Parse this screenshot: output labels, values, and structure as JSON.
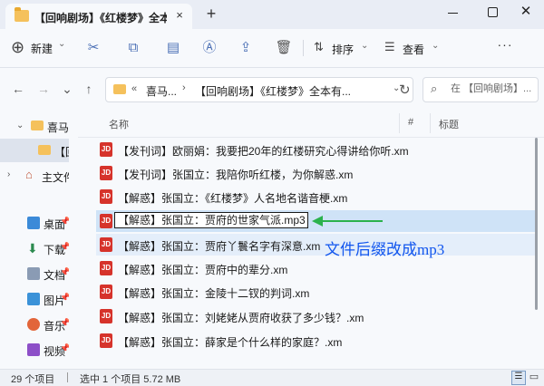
{
  "tab": {
    "title": "【回响剧场】《红楼梦》全本有",
    "close": "×",
    "new_tab": "+"
  },
  "window": {
    "close": "✕"
  },
  "toolbar": {
    "new_label": "新建",
    "sort_label": "排序",
    "view_label": "查看",
    "more_label": "···"
  },
  "address": {
    "prefix": "«",
    "segment1": "喜马...",
    "separator": "›",
    "segment2": "【回响剧场】《红楼梦》全本有...",
    "chevron": "⌄"
  },
  "search": {
    "placeholder": "在 【回响剧场】..."
  },
  "sidebar": {
    "items": [
      {
        "label": "喜马拉",
        "icon": "folder-icon",
        "expanded": true
      },
      {
        "label": "【回",
        "icon": "folder-icon",
        "selected": true
      },
      {
        "label": "主文件",
        "icon": "home-icon"
      },
      {
        "label": "桌面",
        "icon": "desktop-icon",
        "pinned": true
      },
      {
        "label": "下载",
        "icon": "download-icon",
        "pinned": true
      },
      {
        "label": "文档",
        "icon": "document-icon",
        "pinned": true
      },
      {
        "label": "图片",
        "icon": "picture-icon",
        "pinned": true
      },
      {
        "label": "音乐",
        "icon": "music-icon",
        "pinned": true
      },
      {
        "label": "视频",
        "icon": "video-icon",
        "pinned": true
      }
    ]
  },
  "list": {
    "columns": {
      "name": "名称",
      "number": "#",
      "title": "标题"
    },
    "file_icon_label": "JD",
    "files": [
      {
        "name": "【发刊词】欧丽娟：我要把20年的红楼研究心得讲给你听.xm"
      },
      {
        "name": "【发刊词】张国立：我陪你听红楼，为你解惑.xm"
      },
      {
        "name": "【解惑】张国立：《红楼梦》人名地名谐音梗.xm"
      },
      {
        "name": "【解惑】张国立：贾府的世家气派.mp3",
        "selected": true,
        "renaming": true
      },
      {
        "name": "【解惑】张国立：贾府丫鬟名字有深意.xm",
        "highlighted": true
      },
      {
        "name": "【解惑】张国立：贾府中的辈分.xm"
      },
      {
        "name": "【解惑】张国立：金陵十二钗的判词.xm"
      },
      {
        "name": "【解惑】张国立：刘姥姥从贾府收获了多少钱？.xm"
      },
      {
        "name": "【解惑】张国立：薛家是个什么样的家庭？.xm"
      }
    ]
  },
  "annotation": {
    "text": "文件后缀改成mp3",
    "color": "#1155ee",
    "arrow_color": "#2bb24c"
  },
  "status": {
    "count": "29 个项目",
    "selection": "选中 1 个项目 5.72 MB"
  },
  "colors": {
    "accent": "#4a6fb5",
    "selection": "#cfe3f7",
    "file_icon": "#d6332b",
    "folder": "#f5c15c"
  }
}
